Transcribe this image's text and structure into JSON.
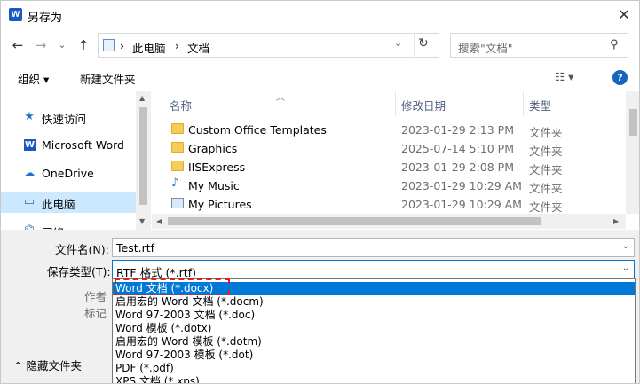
{
  "window": {
    "title": "另存为",
    "app_icon": "W",
    "close_label": "✕"
  },
  "nav": {
    "back": "←",
    "forward": "→",
    "recent": "⌄",
    "up": "↑",
    "breadcrumb": [
      "›",
      "此电脑",
      "›",
      "文档"
    ],
    "refresh": "↻",
    "dropdown": "⌄"
  },
  "search": {
    "placeholder": "搜索\"文档\"",
    "icon": "⚲"
  },
  "toolbar": {
    "organize": "组织 ▾",
    "new_folder": "新建文件夹",
    "view": "☷ ▾",
    "help": "?"
  },
  "sidebar": {
    "items": [
      {
        "label": "快速访问",
        "icon": "star-icon",
        "glyph": "★"
      },
      {
        "label": "Microsoft Word",
        "icon": "word-icon",
        "glyph": "W"
      },
      {
        "label": "OneDrive",
        "icon": "onedrive-icon",
        "glyph": "☁"
      },
      {
        "label": "此电脑",
        "icon": "computer-icon",
        "glyph": "▭"
      },
      {
        "label": "网络",
        "icon": "network-icon",
        "glyph": "⌬"
      }
    ]
  },
  "columns": {
    "name": "名称",
    "date": "修改日期",
    "type": "类型"
  },
  "files": [
    {
      "name": "Custom Office Templates",
      "date": "2023-01-29 2:13 PM",
      "type": "文件夹",
      "icon": "folder-icon"
    },
    {
      "name": "Graphics",
      "date": "2025-07-14 5:10 PM",
      "type": "文件夹",
      "icon": "folder-icon"
    },
    {
      "name": "IISExpress",
      "date": "2023-01-29 2:08 PM",
      "type": "文件夹",
      "icon": "folder-icon"
    },
    {
      "name": "My Music",
      "date": "2023-01-29 10:29 AM",
      "type": "文件夹",
      "icon": "music-icon"
    },
    {
      "name": "My Pictures",
      "date": "2023-01-29 10:29 AM",
      "type": "文件夹",
      "icon": "pictures-icon"
    }
  ],
  "form": {
    "filename_label": "文件名(N):",
    "filename_value": "Test.rtf",
    "filetype_label": "保存类型(T):",
    "filetype_value": "RTF 格式 (*.rtf)",
    "author_label": "作者",
    "tags_label": "标记",
    "hide_folders": "隐藏文件夹"
  },
  "filetype_options": [
    "Word 文档 (*.docx)",
    "启用宏的 Word 文档 (*.docm)",
    "Word 97-2003 文档 (*.doc)",
    "Word 模板 (*.dotx)",
    "启用宏的 Word 模板 (*.dotm)",
    "Word 97-2003 模板 (*.dot)",
    "PDF (*.pdf)",
    "XPS 文档 (*.xps)"
  ],
  "selected_option_index": 0
}
